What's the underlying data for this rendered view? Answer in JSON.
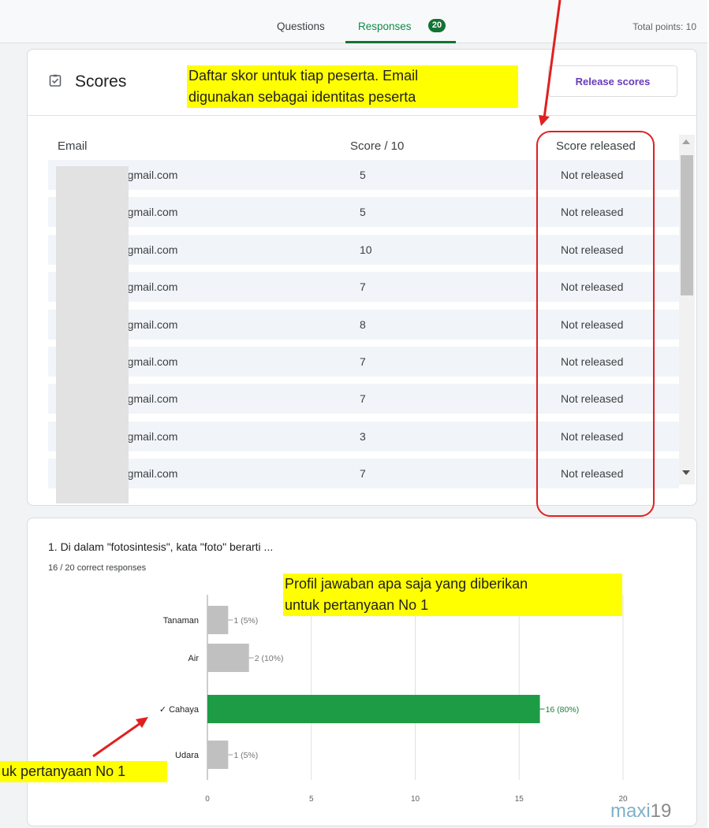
{
  "tabs": {
    "questions": "Questions",
    "responses": "Responses",
    "responses_count": "20",
    "total_points": "Total points: 10"
  },
  "scores": {
    "title": "Scores",
    "release_button": "Release scores",
    "columns": {
      "email": "Email",
      "score": "Score / 10",
      "released": "Score released"
    },
    "rows": [
      {
        "email": ")gmail.com",
        "score": "5",
        "status": "Not released"
      },
      {
        "email": ")gmail.com",
        "score": "5",
        "status": "Not released"
      },
      {
        "email": ")gmail.com",
        "score": "10",
        "status": "Not released"
      },
      {
        "email": ")gmail.com",
        "score": "7",
        "status": "Not released"
      },
      {
        "email": ")gmail.com",
        "score": "8",
        "status": "Not released"
      },
      {
        "email": ")gmail.com",
        "score": "7",
        "status": "Not released"
      },
      {
        "email": ")gmail.com",
        "score": "7",
        "status": "Not released"
      },
      {
        "email": ")gmail.com",
        "score": "3",
        "status": "Not released"
      },
      {
        "email": ")gmail.com",
        "score": "7",
        "status": "Not released"
      }
    ]
  },
  "question": {
    "title": "1. Di dalam \"fotosintesis\", kata \"foto\" berarti ...",
    "correct": "16 / 20 correct responses"
  },
  "annotations": {
    "scores_note_line1": "Daftar skor untuk tiap peserta. Email",
    "scores_note_line2": "digunakan sebagai identitas peserta",
    "profile_note_line1": "Profil jawaban apa saja yang diberikan",
    "profile_note_line2": "untuk pertanyaan No 1",
    "key_note": "uk pertanyaan  No 1"
  },
  "watermark": {
    "part1": "maxi",
    "part2": "19"
  },
  "colors": {
    "correct_bar": "#1e9c45",
    "other_bar": "#c0c0c0",
    "highlight": "#ffff00",
    "annotation_red": "#e02020"
  },
  "chart_data": {
    "type": "bar",
    "orientation": "horizontal",
    "categories": [
      "Tanaman",
      "Air",
      "✓ Cahaya",
      "Udara"
    ],
    "values": [
      1,
      2,
      16,
      1
    ],
    "labels": [
      "1 (5%)",
      "2 (10%)",
      "16 (80%)",
      "1 (5%)"
    ],
    "correct_index": 2,
    "xlim": [
      0,
      20
    ],
    "xticks": [
      "0",
      "5",
      "10",
      "15",
      "20"
    ],
    "grid": true
  }
}
